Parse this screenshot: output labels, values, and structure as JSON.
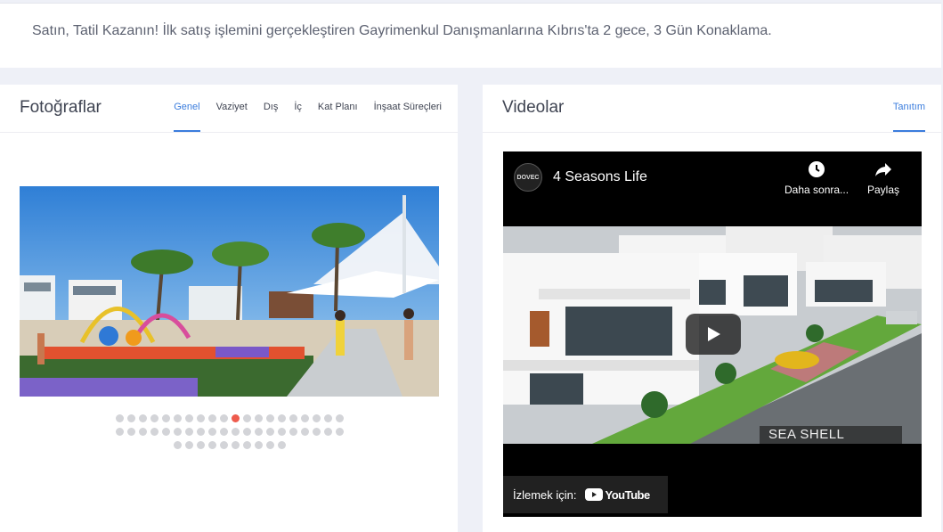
{
  "banner": {
    "text": "Satın, Tatil Kazanın! İlk satış işlemini gerçekleştiren Gayrimenkul Danışmanlarına Kıbrıs'ta 2 gece, 3 Gün Konaklama."
  },
  "photos": {
    "title": "Fotoğraflar",
    "tabs": [
      {
        "label": "Genel",
        "active": true
      },
      {
        "label": "Vaziyet",
        "active": false
      },
      {
        "label": "Dış",
        "active": false
      },
      {
        "label": "İç",
        "active": false
      },
      {
        "label": "Kat Planı",
        "active": false
      },
      {
        "label": "İnşaat Süreçleri",
        "active": false
      }
    ],
    "carousel": {
      "rows": [
        20,
        20,
        10
      ],
      "active_index": 10
    }
  },
  "videos": {
    "title": "Videolar",
    "tabs": [
      {
        "label": "Tanıtım",
        "active": true
      }
    ],
    "player": {
      "channel_logo": "DOVEC",
      "title": "4 Seasons Life",
      "watch_later": "Daha sonra...",
      "share": "Paylaş",
      "overlay_text": "SEA SHELL",
      "watch_on": "İzlemek için:",
      "youtube": "YouTube"
    }
  },
  "colors": {
    "accent": "#3b7ddd",
    "active_dot": "#ee5b4d",
    "inactive_dot": "#d3d4d8",
    "page_bg": "#eef0f7"
  }
}
